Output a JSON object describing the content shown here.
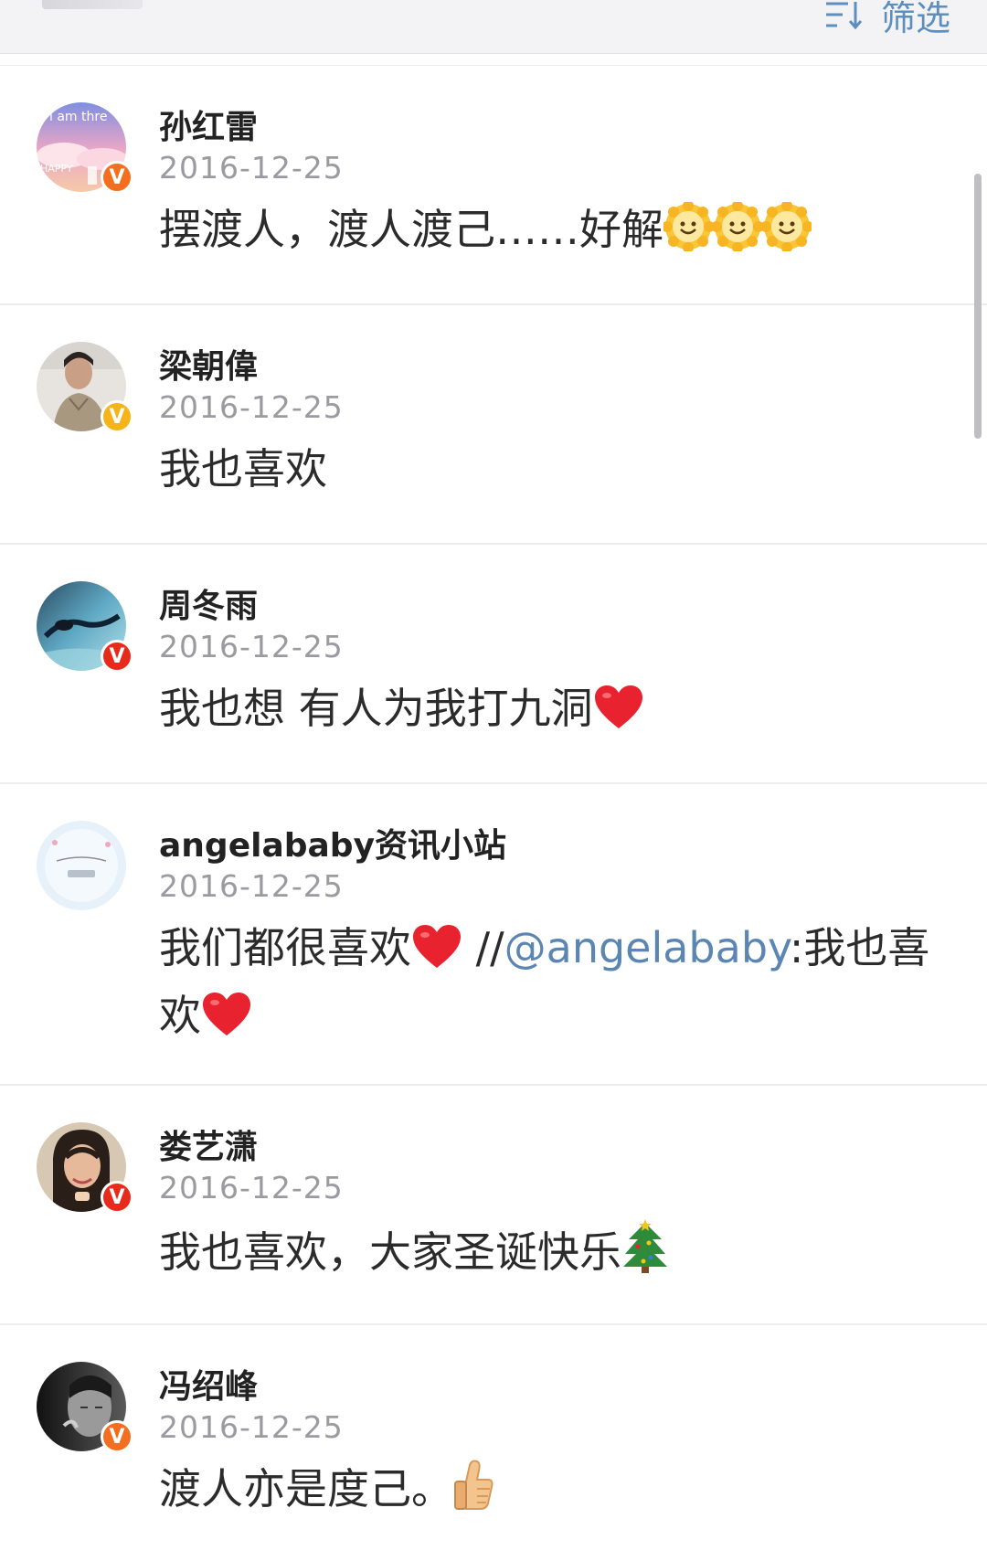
{
  "header": {
    "filter_label": "筛选"
  },
  "comments": [
    {
      "name": "孙红雷",
      "date": "2016-12-25",
      "text": "摆渡人，渡人渡己……好解",
      "emoji": "sun-smile-icon",
      "emoji_count": 3,
      "badge_color": "#f36e1e"
    },
    {
      "name": "梁朝偉",
      "date": "2016-12-25",
      "text": "我也喜欢",
      "badge_color": "#f5b519"
    },
    {
      "name": "周冬雨",
      "date": "2016-12-25",
      "text": "我也想 有人为我打九洞",
      "emoji": "heart-icon",
      "badge_color": "#e82a1b"
    },
    {
      "name": "angelababy资讯小站",
      "date": "2016-12-25",
      "text_a": "我们都很喜欢",
      "text_b": " //",
      "mention": "@angelababy",
      "text_c": ":我也喜欢",
      "emoji": "heart-icon"
    },
    {
      "name": "娄艺潇",
      "date": "2016-12-25",
      "text": "我也喜欢，大家圣诞快乐",
      "emoji": "christmas-tree-icon",
      "badge_color": "#e82a1b"
    },
    {
      "name": "冯绍峰",
      "date": "2016-12-25",
      "text": "渡人亦是度己。",
      "emoji": "thumbs-up-icon",
      "badge_color": "#f36e1e"
    }
  ],
  "colors": {
    "link": "#5b86b4",
    "date": "#9a9aa0",
    "divider": "#ececee"
  }
}
